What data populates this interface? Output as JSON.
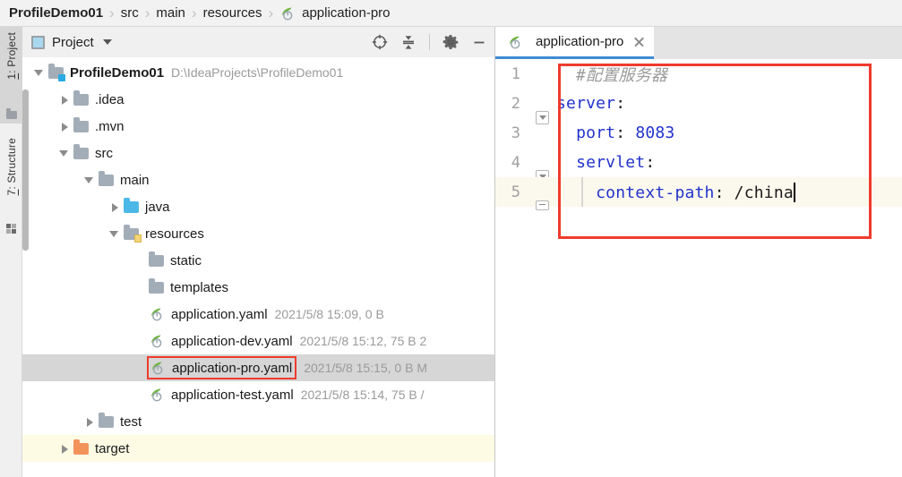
{
  "breadcrumb": {
    "separator": "›",
    "items": [
      {
        "label": "ProfileDemo01",
        "bold": true,
        "icon": null
      },
      {
        "label": "src",
        "bold": false,
        "icon": null
      },
      {
        "label": "main",
        "bold": false,
        "icon": null
      },
      {
        "label": "resources",
        "bold": false,
        "icon": null
      },
      {
        "label": "application-pro",
        "bold": false,
        "icon": "spring-yaml-icon"
      }
    ]
  },
  "tool_strip": {
    "buttons": [
      {
        "label": "1: Project",
        "accel": "1",
        "icon": "folder-icon",
        "active": true
      },
      {
        "label": "7: Structure",
        "accel": "7",
        "icon": "structure-grid-icon",
        "active": false
      }
    ]
  },
  "project_panel": {
    "title": "Project",
    "tools": [
      {
        "name": "locate-target-icon",
        "tooltip": "Select Opened File"
      },
      {
        "name": "collapse-all-icon",
        "tooltip": "Collapse All"
      },
      {
        "name": "gear-icon",
        "tooltip": "Settings"
      },
      {
        "name": "minimize-icon",
        "tooltip": "Hide"
      }
    ],
    "tree": [
      {
        "indent": 0,
        "arrow": "down",
        "icon": "folder-module-icon",
        "label": "ProfileDemo01",
        "bold": true,
        "meta": "D:\\IdeaProjects\\ProfileDemo01",
        "state": "normal"
      },
      {
        "indent": 1,
        "arrow": "right",
        "icon": "folder-icon",
        "label": ".idea",
        "bold": false,
        "meta": "",
        "state": "normal"
      },
      {
        "indent": 1,
        "arrow": "right",
        "icon": "folder-icon",
        "label": ".mvn",
        "bold": false,
        "meta": "",
        "state": "normal"
      },
      {
        "indent": 1,
        "arrow": "down",
        "icon": "folder-icon",
        "label": "src",
        "bold": false,
        "meta": "",
        "state": "normal"
      },
      {
        "indent": 2,
        "arrow": "down",
        "icon": "folder-icon",
        "label": "main",
        "bold": false,
        "meta": "",
        "state": "normal"
      },
      {
        "indent": 3,
        "arrow": "right",
        "icon": "folder-blue-icon",
        "label": "java",
        "bold": false,
        "meta": "",
        "state": "normal"
      },
      {
        "indent": 3,
        "arrow": "down",
        "icon": "folder-resources-icon",
        "label": "resources",
        "bold": false,
        "meta": "",
        "state": "normal"
      },
      {
        "indent": 4,
        "arrow": "none",
        "icon": "folder-icon",
        "label": "static",
        "bold": false,
        "meta": "",
        "state": "normal"
      },
      {
        "indent": 4,
        "arrow": "none",
        "icon": "folder-icon",
        "label": "templates",
        "bold": false,
        "meta": "",
        "state": "normal"
      },
      {
        "indent": 4,
        "arrow": "none",
        "icon": "spring-yaml-icon",
        "label": "application.yaml",
        "bold": false,
        "meta": "2021/5/8 15:09, 0 B",
        "state": "normal"
      },
      {
        "indent": 4,
        "arrow": "none",
        "icon": "spring-yaml-icon",
        "label": "application-dev.yaml",
        "bold": false,
        "meta": "2021/5/8 15:12, 75 B 2",
        "state": "normal"
      },
      {
        "indent": 4,
        "arrow": "none",
        "icon": "spring-yaml-icon",
        "label": "application-pro.yaml",
        "bold": false,
        "meta": "2021/5/8 15:15, 0 B M",
        "state": "selected",
        "annotated": true
      },
      {
        "indent": 4,
        "arrow": "none",
        "icon": "spring-yaml-icon",
        "label": "application-test.yaml",
        "bold": false,
        "meta": "2021/5/8 15:14, 75 B /",
        "state": "normal"
      },
      {
        "indent": 2,
        "arrow": "right",
        "icon": "folder-icon",
        "label": "test",
        "bold": false,
        "meta": "",
        "state": "normal"
      },
      {
        "indent": 1,
        "arrow": "right",
        "icon": "folder-orange-icon",
        "label": "target",
        "bold": false,
        "meta": "",
        "state": "highlighted"
      }
    ]
  },
  "editor": {
    "tab": {
      "label": "application-pro",
      "icon": "spring-yaml-icon",
      "close": "close-icon",
      "active": true
    },
    "lines": [
      {
        "num": "1",
        "fold": "none",
        "indent_guide": false,
        "tokens": [
          {
            "t": "#配置服务器",
            "cls": "tok-comment"
          }
        ],
        "current": false,
        "pad": 22
      },
      {
        "num": "2",
        "fold": "collapse",
        "indent_guide": false,
        "tokens": [
          {
            "t": "server",
            "cls": "tok-key"
          },
          {
            "t": ":",
            "cls": "tok-punct"
          }
        ],
        "current": false,
        "pad": 0
      },
      {
        "num": "3",
        "fold": "none",
        "indent_guide": false,
        "tokens": [
          {
            "t": "  port",
            "cls": "tok-key"
          },
          {
            "t": ": ",
            "cls": "tok-punct"
          },
          {
            "t": "8083",
            "cls": "tok-num"
          }
        ],
        "current": false,
        "pad": 0
      },
      {
        "num": "4",
        "fold": "collapse",
        "indent_guide": false,
        "tokens": [
          {
            "t": "  servlet",
            "cls": "tok-key"
          },
          {
            "t": ":",
            "cls": "tok-punct"
          }
        ],
        "current": false,
        "pad": 0
      },
      {
        "num": "5",
        "fold": "end",
        "indent_guide": true,
        "tokens": [
          {
            "t": "    context-path",
            "cls": "tok-key"
          },
          {
            "t": ": ",
            "cls": "tok-punct"
          },
          {
            "t": "/china",
            "cls": "tok-val"
          }
        ],
        "current": true,
        "pad": 0,
        "caret": true
      }
    ]
  },
  "colors": {
    "accent_blue": "#3d8bd4",
    "annotation_red": "#ef3b2d",
    "key_blue": "#2233cc",
    "comment_gray": "#9a9a9a",
    "selection_gray": "#d6d6d6",
    "highlight_yellow": "#fdfbe4",
    "current_line": "#fbf8ed"
  }
}
